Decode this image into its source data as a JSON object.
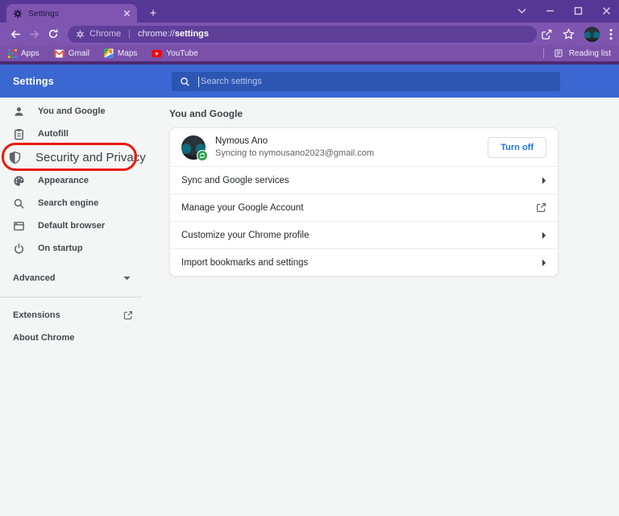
{
  "window": {
    "tab_title": "Settings",
    "new_tab_glyph": "+"
  },
  "toolbar": {
    "product_label": "Chrome",
    "url_divider": "|",
    "url_scheme": "chrome://",
    "url_path": "settings"
  },
  "bookmarks": {
    "items": [
      {
        "label": "Apps",
        "icon": "apps-grid-icon"
      },
      {
        "label": "Gmail",
        "icon": "gmail-icon"
      },
      {
        "label": "Maps",
        "icon": "maps-icon"
      },
      {
        "label": "YouTube",
        "icon": "youtube-icon"
      }
    ],
    "reading_list_label": "Reading list"
  },
  "settings_header": {
    "title": "Settings",
    "search_placeholder": "Search settings"
  },
  "sidebar": {
    "items": [
      {
        "label": "You and Google",
        "icon": "person-icon"
      },
      {
        "label": "Autofill",
        "icon": "clipboard-icon"
      },
      {
        "label": "Security and Privacy",
        "icon": "shield-icon",
        "highlighted": true
      },
      {
        "label": "Appearance",
        "icon": "palette-icon"
      },
      {
        "label": "Search engine",
        "icon": "magnifier-icon"
      },
      {
        "label": "Default browser",
        "icon": "browser-window-icon"
      },
      {
        "label": "On startup",
        "icon": "power-icon"
      }
    ],
    "advanced_label": "Advanced",
    "footer_items": [
      {
        "label": "Extensions",
        "icon": "external-link-icon"
      },
      {
        "label": "About Chrome"
      }
    ]
  },
  "main": {
    "section_title": "You and Google",
    "profile": {
      "name": "Nymous Ano",
      "status": "Syncing to nymousano2023@gmail.com",
      "action_label": "Turn off"
    },
    "rows": [
      {
        "label": "Sync and Google services",
        "trailing": "chevron-right-icon"
      },
      {
        "label": "Manage your Google Account",
        "trailing": "external-link-icon"
      },
      {
        "label": "Customize your Chrome profile",
        "trailing": "chevron-right-icon"
      },
      {
        "label": "Import bookmarks and settings",
        "trailing": "chevron-right-icon"
      }
    ]
  },
  "annotation": {
    "shape": "rounded-rectangle",
    "color": "#e81a0e",
    "target": "Security and Privacy"
  },
  "colors": {
    "frame": "#573795",
    "toolbar": "#7e56b1",
    "url_field": "#5f3e99",
    "bookmarks_bar": "#7a51a9",
    "header_blue": "#3a67d1",
    "search_field_blue": "#2c56b2",
    "accent_link": "#1a73e8",
    "sync_badge_green": "#2f9e4b",
    "page_background": "#f4f5f5"
  }
}
